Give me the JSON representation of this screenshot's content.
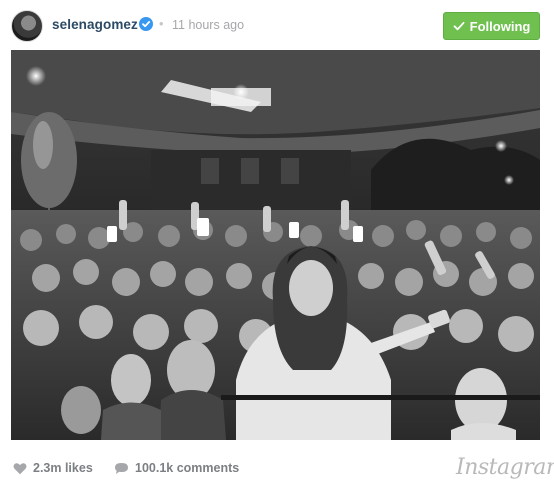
{
  "post": {
    "username": "selenagomez",
    "separator": "•",
    "timestamp": "11 hours ago",
    "verified_icon": "verified-badge-icon",
    "follow_label": "Following",
    "follow_color": "#70c050",
    "username_color": "#2c4a66"
  },
  "photo": {
    "style": "black-and-white"
  },
  "footer": {
    "likes": "2.3m likes",
    "comments": "100.1k comments",
    "brand": "Instagram",
    "heart_icon": "heart-icon",
    "comment_icon": "comment-bubble-icon"
  }
}
